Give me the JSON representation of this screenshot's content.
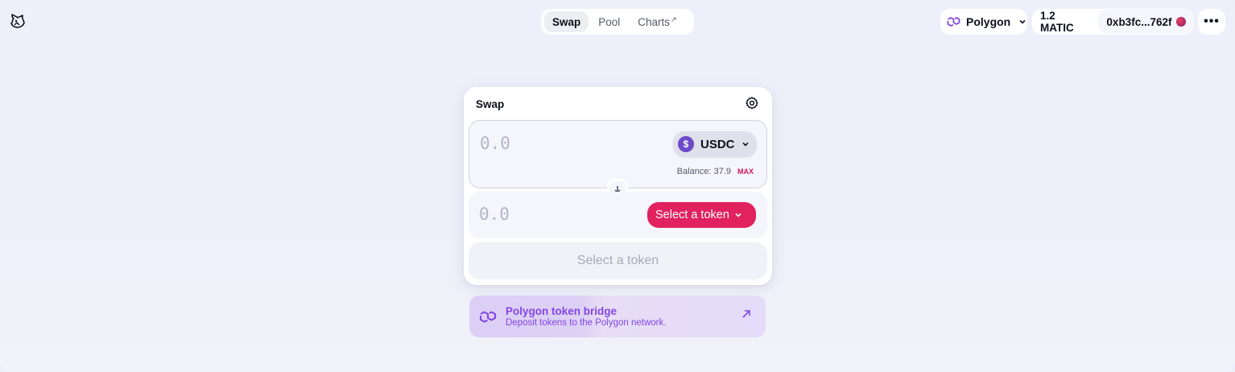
{
  "header": {
    "nav": [
      {
        "label": "Swap"
      },
      {
        "label": "Pool"
      },
      {
        "label": "Charts",
        "suffix": "↗"
      }
    ],
    "network": {
      "label": "Polygon"
    },
    "account": {
      "balance": "1.2 MATIC",
      "address": "0xb3fc...762f"
    },
    "more_label": "•••"
  },
  "swap": {
    "title": "Swap",
    "input": {
      "amount_placeholder": "0.0",
      "token": "USDC",
      "balance_label": "Balance: 37.9",
      "max_label": "MAX"
    },
    "output": {
      "amount_placeholder": "0.0",
      "select_label": "Select a token"
    },
    "cta_label": "Select a token"
  },
  "bridge": {
    "title": "Polygon token bridge",
    "subtitle": "Deposit tokens to the Polygon network."
  },
  "colors": {
    "accent_pink": "#e1225f",
    "polygon_purple": "#8247e5",
    "usdc_icon": "#6d4bc8"
  }
}
